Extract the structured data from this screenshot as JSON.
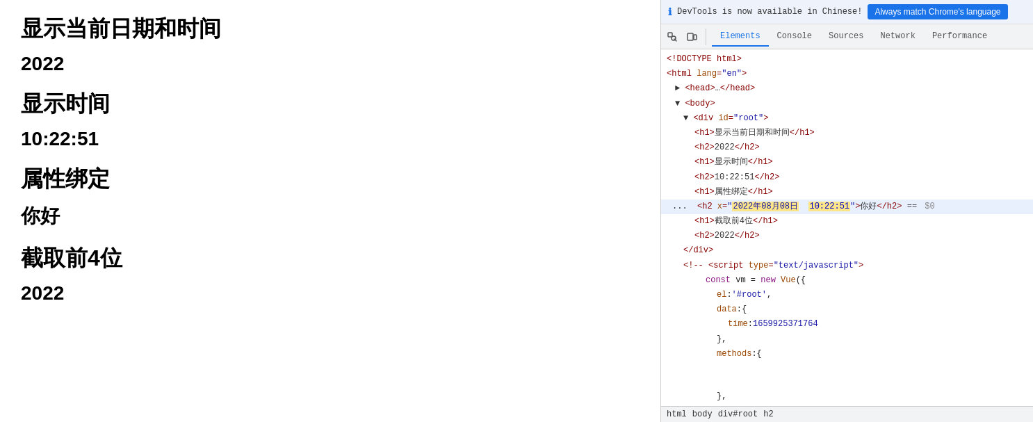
{
  "left": {
    "items": [
      {
        "type": "h1",
        "text": "显示当前日期和时间"
      },
      {
        "type": "h2",
        "text": "2022"
      },
      {
        "type": "h1",
        "text": "显示时间"
      },
      {
        "type": "h2",
        "text": "10:22:51"
      },
      {
        "type": "h1",
        "text": "属性绑定"
      },
      {
        "type": "h2",
        "text": "你好"
      },
      {
        "type": "h1",
        "text": "截取前4位"
      },
      {
        "type": "h2",
        "text": "2022"
      }
    ]
  },
  "devtools": {
    "infobar": {
      "text": "DevTools is now available in Chinese!",
      "button": "Always match Chrome's language"
    },
    "tabs": [
      "Elements",
      "Console",
      "Sources",
      "Network",
      "Performance"
    ],
    "active_tab": "Elements",
    "breadcrumb": [
      "html",
      "body",
      "div#root",
      "h2"
    ]
  }
}
